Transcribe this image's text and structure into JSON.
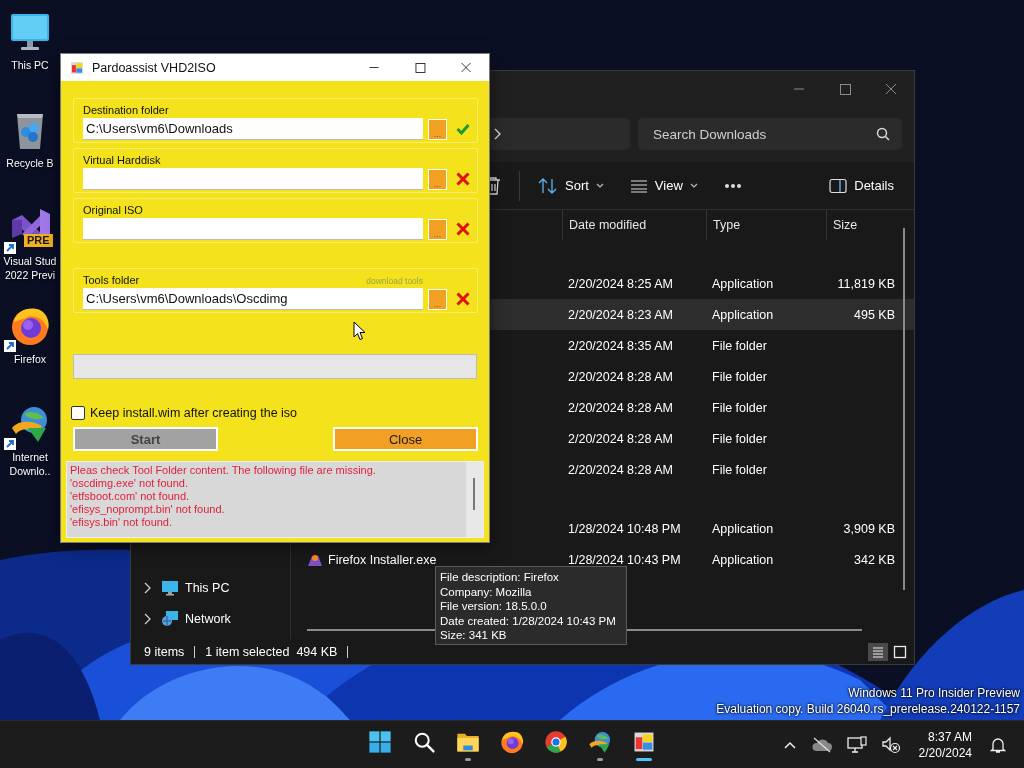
{
  "desktop_icons": [
    {
      "kind": "monitor",
      "lines": [
        "This PC"
      ],
      "shortcut": false
    },
    {
      "kind": "recycle",
      "lines": [
        "Recycle B"
      ],
      "shortcut": false
    },
    {
      "kind": "studio",
      "lines": [
        "Visual Stud",
        "2022 Previ"
      ],
      "badge": "PRE",
      "shortcut": true
    },
    {
      "kind": "firefox",
      "lines": [
        "Firefox"
      ],
      "shortcut": true
    },
    {
      "kind": "downloader",
      "lines": [
        "Internet",
        "Downlo.."
      ],
      "shortcut": true
    }
  ],
  "explorer": {
    "search": {
      "placeholder": "Search Downloads"
    },
    "toolbar": {
      "sort": "Sort",
      "view": "View",
      "details": "Details"
    },
    "columns": [
      "Date modified",
      "Type",
      "Size"
    ],
    "groups": [
      {
        "rows": [
          {
            "date": "2/20/2024 8:25 AM",
            "type": "Application",
            "size": "11,819 KB",
            "selected": false
          },
          {
            "date": "2/20/2024 8:23 AM",
            "type": "Application",
            "size": "495 KB",
            "selected": true
          },
          {
            "date": "2/20/2024 8:35 AM",
            "type": "File folder",
            "selected": false
          },
          {
            "date": "2/20/2024 8:28 AM",
            "type": "File folder",
            "selected": false
          },
          {
            "date": "2/20/2024 8:28 AM",
            "type": "File folder",
            "selected": false
          },
          {
            "date": "2/20/2024 8:28 AM",
            "type": "File folder",
            "selected": false
          },
          {
            "date": "2/20/2024 8:28 AM",
            "type": "File folder",
            "selected": false
          }
        ]
      },
      {
        "rows": [
          {
            "date": "1/28/2024 10:48 PM",
            "type": "Application",
            "size": "3,909 KB",
            "selected": false
          },
          {
            "name": "Firefox Installer.exe",
            "date": "1/28/2024 10:43 PM",
            "type": "Application",
            "size": "342 KB",
            "selected": false
          }
        ]
      }
    ],
    "nav": [
      {
        "kind": "pc",
        "label": "This PC"
      },
      {
        "kind": "network",
        "label": "Network"
      }
    ],
    "status": {
      "items": "9 items",
      "selection": "1 item selected",
      "size": "494 KB"
    },
    "view_modes": [
      {
        "kind": "details",
        "selected": true
      },
      {
        "kind": "tiles",
        "selected": false
      }
    ],
    "tooltip": [
      "File description: Firefox",
      "Company: Mozilla",
      "File version: 18.5.0.0",
      "Date created: 1/28/2024 10:43 PM",
      "Size: 341 KB"
    ]
  },
  "dialog": {
    "title": "Pardoassist VHD2ISO",
    "fields": [
      {
        "label": "Destination folder",
        "value": "C:\\Users\\vm6\\Downloads",
        "browse": "...",
        "valid": true
      },
      {
        "label": "Virtual Harddisk",
        "browse": "...",
        "valid": false
      },
      {
        "label": "Original ISO",
        "browse": "...",
        "valid": false
      },
      {
        "label": "Tools folder",
        "link": "download tools",
        "value": "C:\\Users\\vm6\\Downloads\\Oscdimg",
        "browse": "...",
        "valid": false
      }
    ],
    "progress": {
      "level": 0
    },
    "checkbox": {
      "label": "Keep install.wim after creating the iso",
      "checked": false
    },
    "buttons": [
      {
        "label": "Start",
        "disabled": true
      },
      {
        "label": "Close",
        "disabled": false
      }
    ],
    "log": [
      "Pleas check Tool Folder content. The following file are missing.",
      "'oscdimg.exe' not found.",
      "'etfsboot.com' not found.",
      "'efisys_noprompt.bin' not found.",
      "'efisys.bin' not found."
    ]
  },
  "watermark": [
    "Windows 11 Pro Insider Preview",
    "Evaluation copy. Build 26040.rs_prerelease.240122-1157"
  ],
  "taskbar": {
    "apps": [
      {
        "kind": "start",
        "running": false,
        "active": false
      },
      {
        "kind": "search",
        "running": false,
        "active": false
      },
      {
        "kind": "folder",
        "running": true,
        "active": false
      },
      {
        "kind": "firefox",
        "running": false,
        "active": false
      },
      {
        "kind": "chrome",
        "running": false,
        "active": false
      },
      {
        "kind": "downloader",
        "running": true,
        "active": false
      },
      {
        "kind": "pardo",
        "running": true,
        "active": true
      }
    ],
    "clock": {
      "time": "8:37 AM",
      "date": "2/20/2024"
    }
  }
}
